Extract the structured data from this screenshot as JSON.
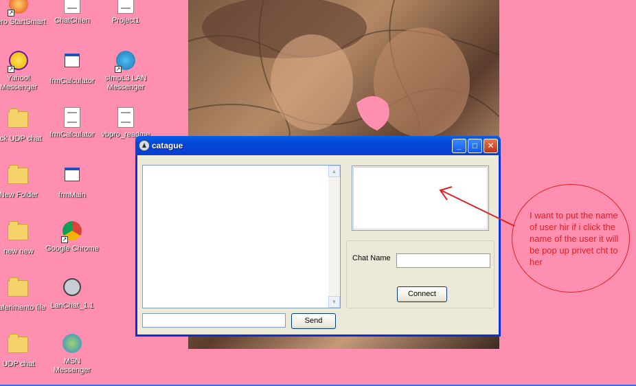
{
  "desktop": {
    "icons": [
      {
        "label": "Nero StartSmart",
        "icon": "nero-icon"
      },
      {
        "label": "ChatChien",
        "icon": "vb-doc-icon"
      },
      {
        "label": "Project1",
        "icon": "vb-doc-icon"
      },
      {
        "label": "Yahoo! Messenger",
        "icon": "yahoo-messenger-icon"
      },
      {
        "label": "frmCalculator",
        "icon": "vb-form-icon"
      },
      {
        "label": "s!mpL3 LAN Messenger",
        "icon": "globe-icon"
      },
      {
        "label": "ack UDP chat",
        "icon": "folder-icon"
      },
      {
        "label": "frmCalculator",
        "icon": "vb-doc-icon"
      },
      {
        "label": "vbpro_readme",
        "icon": "text-doc-icon"
      },
      {
        "label": "New Folder",
        "icon": "folder-icon"
      },
      {
        "label": "frmMain",
        "icon": "vb-form-icon"
      },
      {
        "label": "new new",
        "icon": "folder-icon"
      },
      {
        "label": "Google Chrome",
        "icon": "chrome-icon"
      },
      {
        "label": "Traferimento file",
        "icon": "folder-icon"
      },
      {
        "label": "LanChat_1.1",
        "icon": "lanchat-icon"
      },
      {
        "label": "UDP chat",
        "icon": "folder-icon"
      },
      {
        "label": "MSN Messenger",
        "icon": "msn-messenger-icon"
      }
    ]
  },
  "window": {
    "title": "catague",
    "minimize_glyph": "_",
    "maximize_glyph": "□",
    "close_glyph": "✕",
    "chat_name_label": "Chat Name",
    "chat_name_value": "",
    "message_value": "",
    "connect_label": "Connect",
    "send_label": "Send"
  },
  "annotation": {
    "note": "I want to put the name of user hir if i click the name of the user it will be pop up privet cht to her",
    "color": "#e02020"
  }
}
